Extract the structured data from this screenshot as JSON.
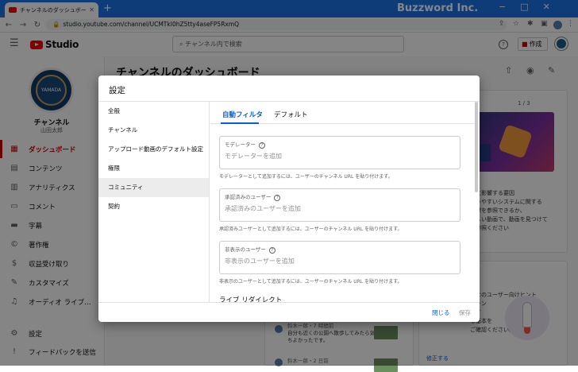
{
  "browser": {
    "tab_title": "チャンネルのダッシュボード - YouTube",
    "new_tab": "+",
    "brand_text": "Buzzword Inc.",
    "url": "studio.youtube.com/channel/UCMTkI0hZ5tty4aseFP5RxmQ",
    "window_controls": [
      "−",
      "□",
      "✕"
    ]
  },
  "header": {
    "logo_text": "Studio",
    "search_placeholder": "チャンネル内で検索",
    "help": "?",
    "create_label": "作成"
  },
  "sidebar": {
    "avatar_text": "YAMADA",
    "channel_label": "チャンネル",
    "channel_owner": "山田太郎",
    "items": [
      {
        "label": "ダッシュボード",
        "icon": "dashboard-icon",
        "glyph": "▦",
        "active": true
      },
      {
        "label": "コンテンツ",
        "icon": "content-icon",
        "glyph": "▤"
      },
      {
        "label": "アナリティクス",
        "icon": "analytics-icon",
        "glyph": "▥"
      },
      {
        "label": "コメント",
        "icon": "comments-icon",
        "glyph": "▭"
      },
      {
        "label": "字幕",
        "icon": "subtitles-icon",
        "glyph": "▬"
      },
      {
        "label": "著作権",
        "icon": "copyright-icon",
        "glyph": "©"
      },
      {
        "label": "収益受け取り",
        "icon": "monetization-icon",
        "glyph": "$"
      },
      {
        "label": "カスタマイズ",
        "icon": "customize-icon",
        "glyph": "✎"
      },
      {
        "label": "オーディオ ライブ…",
        "icon": "audio-library-icon",
        "glyph": "♫"
      }
    ],
    "bottom_items": [
      {
        "label": "設定",
        "icon": "settings-icon",
        "glyph": "⚙"
      },
      {
        "label": "フィードバックを送信",
        "icon": "feedback-icon",
        "glyph": "!"
      }
    ]
  },
  "main": {
    "page_title": "チャンネルのダッシュボード",
    "pager": "1 / 3",
    "bg_text_1": "スに影響する要因\nかりやすいシステムに関する\n指標を参照できるか、\n新しい動画で、動画を見つけて\nを参照ください",
    "bg_text_2": "案\nかなのユーザー向けヒント\nチャン\nスす\nる基本を\nご確認ください。",
    "comments": [
      {
        "name": "鈴木一郎・7 時間前",
        "text": "自分も近くの公園へ散歩してみたら気持ちよかったです。"
      },
      {
        "name": "鈴木一郎・2 日前",
        "text": ""
      }
    ],
    "edit_link": "修正する"
  },
  "dialog": {
    "title": "設定",
    "nav": [
      {
        "label": "全般",
        "selected": false
      },
      {
        "label": "チャンネル",
        "selected": false
      },
      {
        "label": "アップロード動画のデフォルト設定",
        "selected": false
      },
      {
        "label": "権限",
        "selected": false
      },
      {
        "label": "コミュニティ",
        "selected": true
      },
      {
        "label": "契約",
        "selected": false
      }
    ],
    "tabs": [
      {
        "label": "自動フィルタ",
        "selected": true
      },
      {
        "label": "デフォルト",
        "selected": false
      }
    ],
    "fields": [
      {
        "label": "モデレーター",
        "placeholder": "モデレーターを追加",
        "hint": "モデレーターとして追加するには、ユーザーのチャンネル URL を貼り付けます。"
      },
      {
        "label": "承認済みのユーザー",
        "placeholder": "承認済みのユーザーを追加",
        "hint": "承認済みユーザーとして追加するには、ユーザーのチャンネル URL を貼り付けます。"
      },
      {
        "label": "非表示のユーザー",
        "placeholder": "非表示のユーザーを追加",
        "hint": "非表示のユーザーとして追加するには、ユーザーのチャンネル URL を貼り付けます。"
      }
    ],
    "section_title": "ライブ リダイレクト",
    "close_label": "閉じる",
    "save_label": "保存"
  }
}
